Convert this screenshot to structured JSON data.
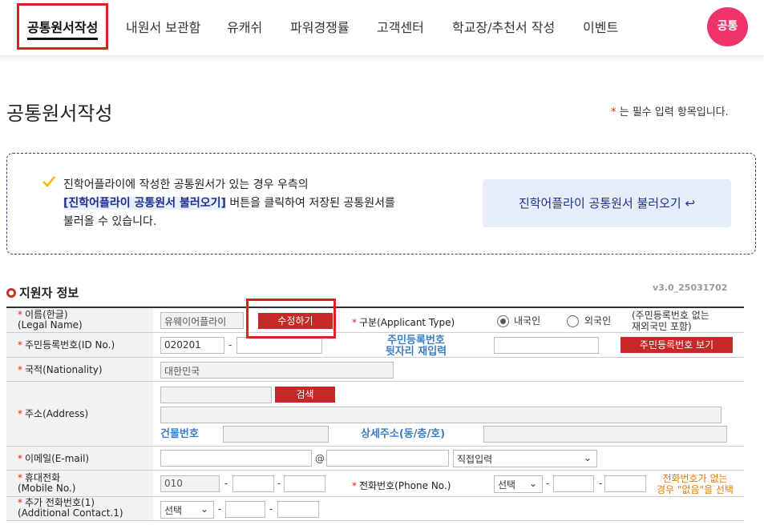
{
  "nav": {
    "items": [
      "공통원서작성",
      "내원서 보관함",
      "유캐쉬",
      "파워경쟁률",
      "고객센터",
      "학교장/추천서 작성",
      "이벤트"
    ],
    "avatar": "공통"
  },
  "page": {
    "title": "공통원서작성",
    "required_star": "*",
    "required_note": " 는 필수 입력 항목입니다."
  },
  "info": {
    "line1": "진학어플라이에 작성한 공통원서가 있는 경우 우측의",
    "line2_strong": "[진학어플라이 공통원서 불러오기]",
    "line2_rest": " 버튼을 클릭하여 저장된 공통원서를",
    "line3": "불러올 수 있습니다.",
    "load_button": "진학어플라이 공통원서 불러오기 ↩"
  },
  "section": {
    "title": "지원자 정보",
    "version": "v3.0_25031702"
  },
  "form": {
    "name_label": "이름(한글)",
    "name_label_en": "(Legal Name)",
    "name_value": "유웨이어플라이",
    "edit_button": "수정하기",
    "type_label": "구분(Applicant Type)",
    "type_domestic": "내국인",
    "type_foreign": "외국인",
    "type_note_1": "(주민등록번호 없는",
    "type_note_2": "재외국민 포함)",
    "id_label": "주민등록번호(ID No.)",
    "id_front": "020201",
    "id_reenter_1": "주민등록번호",
    "id_reenter_2": "뒷자리 재입력",
    "id_show_button": "주민등록번호 보기",
    "nationality_label": "국적(Nationality)",
    "nationality_value": "대한민국",
    "address_label": "주소(Address)",
    "address_search": "검색",
    "building_no": "건물번호",
    "address_detail": "상세주소(동/층/호)",
    "email_label": "이메일(E-mail)",
    "email_at": "@",
    "email_domain_select": "직접입력",
    "mobile_label": "휴대전화",
    "mobile_label_en": "(Mobile No.)",
    "mobile_prefix": "010",
    "phone_label": "전화번호(Phone No.)",
    "phone_select": "선택",
    "phone_note_1": "전화번호가 없는",
    "phone_note_2": "경우 \"없음\"을 선택",
    "extra_label": "추가 전화번호(1)",
    "extra_label_en": "(Additional Contact.1)",
    "extra_select": "선택",
    "dash": "-"
  }
}
